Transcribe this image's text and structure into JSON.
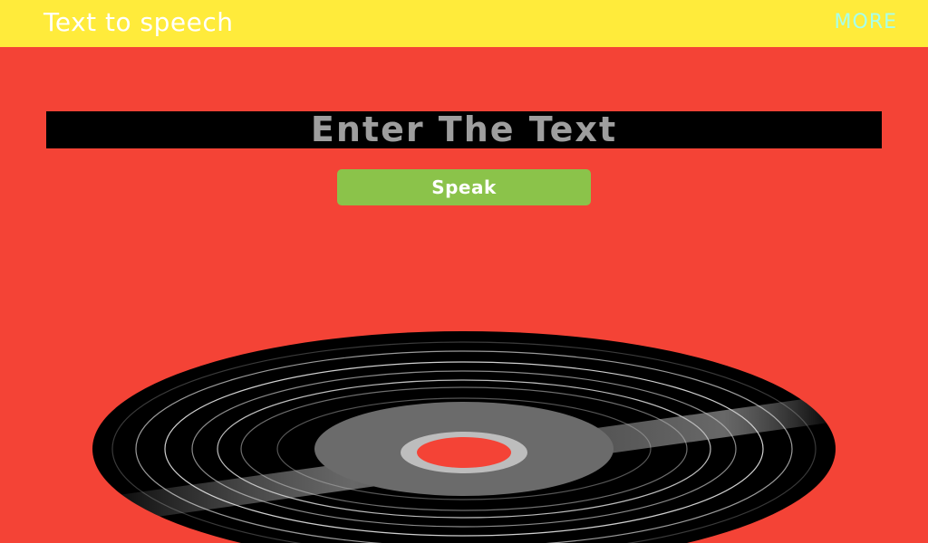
{
  "app_bar": {
    "title": "Text to speech",
    "more_label": "MORE",
    "color": "#FFEB3B"
  },
  "main": {
    "background": "#F44336",
    "text_input": {
      "value": "",
      "placeholder": "Enter The Text"
    },
    "speak_button": {
      "label": "Speak",
      "color": "#8BC34A"
    }
  },
  "vinyl": {
    "icon": "vinyl-record-icon"
  }
}
